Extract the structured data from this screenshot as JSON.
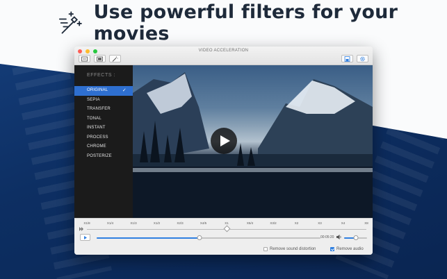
{
  "headline": {
    "text": "Use powerful filters for your movies",
    "icon": "magic-wand-icon"
  },
  "window": {
    "title": "VIDEO ACCELERATION",
    "toolbar_left": [
      "open-file-icon",
      "export-icon",
      "magic-wand-icon"
    ],
    "toolbar_right": [
      "save-icon",
      "gear-icon"
    ]
  },
  "effects": {
    "title": "EFFECTS :",
    "items": [
      {
        "label": "ORIGINAL",
        "selected": true
      },
      {
        "label": "SEPIA",
        "selected": false
      },
      {
        "label": "TRANSFER",
        "selected": false
      },
      {
        "label": "TONAL",
        "selected": false
      },
      {
        "label": "INSTANT",
        "selected": false
      },
      {
        "label": "PROCESS",
        "selected": false
      },
      {
        "label": "CHROME",
        "selected": false
      },
      {
        "label": "POSTERIZE",
        "selected": false
      }
    ],
    "check_glyph": "✓"
  },
  "player": {
    "speed_ticks": [
      "X1/8",
      "X1/4",
      "X1/3",
      "X1/2",
      "X2/3",
      "X4/5",
      "X1",
      "X5/4",
      "X3/2",
      "X2",
      "X3",
      "X4",
      "X8"
    ],
    "speed_selected": "X1",
    "seek_progress": 0.46,
    "time": "00:05:20",
    "volume_level": 0.5
  },
  "options": {
    "remove_sound_distortion": {
      "label": "Remove sound distortion",
      "checked": false
    },
    "remove_audio": {
      "label": "Remove audio",
      "checked": true
    }
  },
  "colors": {
    "accent": "#2f7fe0",
    "selection": "#2e6fd0",
    "sidebar_bg": "#1b1b1b"
  }
}
